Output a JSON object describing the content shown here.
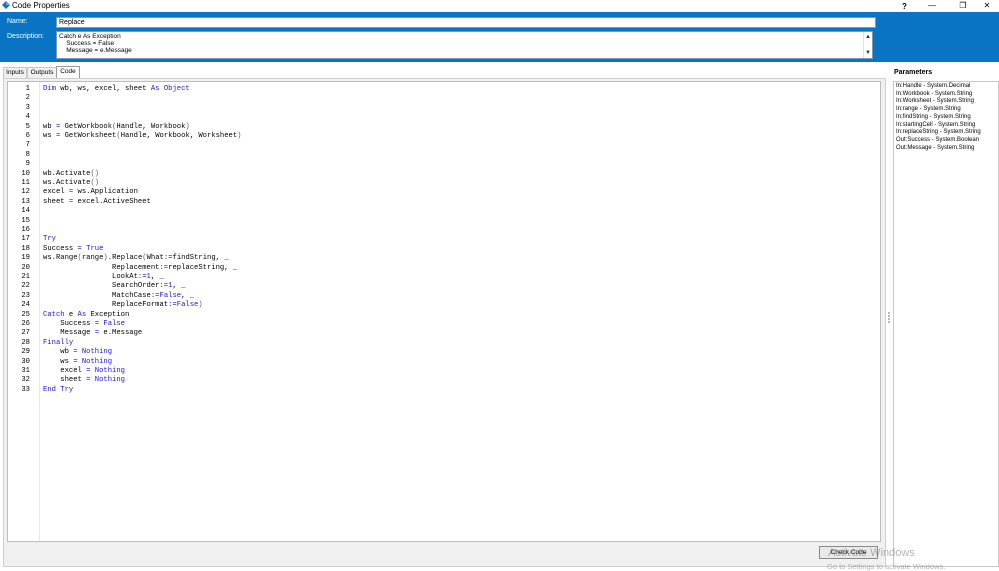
{
  "window": {
    "title": "Code Properties",
    "help": "?",
    "minimize": "—",
    "restore": "❐",
    "close": "✕"
  },
  "header": {
    "name_label": "Name:",
    "name_value": "Replace",
    "description_label": "Description:",
    "description_lines": [
      "Catch e As Exception",
      "    Success = False",
      "    Message = e.Message",
      "_"
    ],
    "scroll_up": "▲",
    "scroll_down": "▼"
  },
  "tabs": [
    "Inputs",
    "Outputs",
    "Code"
  ],
  "active_tab": "Code",
  "code": {
    "line_numbers": [
      "1",
      "2",
      "3",
      "4",
      "5",
      "6",
      "7",
      "8",
      "9",
      "10",
      "11",
      "12",
      "13",
      "14",
      "15",
      "16",
      "17",
      "18",
      "19",
      "20",
      "21",
      "22",
      "23",
      "24",
      "25",
      "26",
      "27",
      "28",
      "29",
      "30",
      "31",
      "32",
      "33"
    ],
    "lines": [
      "Dim wb, ws, excel, sheet As Object",
      "",
      "",
      "",
      "wb = GetWorkbook(Handle, Workbook)",
      "ws = GetWorksheet(Handle, Workbook, Worksheet)",
      "",
      "",
      "",
      "wb.Activate()",
      "ws.Activate()",
      "excel = ws.Application",
      "sheet = excel.ActiveSheet",
      "",
      "",
      "",
      "Try",
      "Success = True",
      "ws.Range(range).Replace(What:=findString, _",
      "                Replacement:=replaceString, _",
      "                LookAt:=1, _",
      "                SearchOrder:=1, _",
      "                MatchCase:=False, _",
      "                ReplaceFormat:=False)",
      "Catch e As Exception",
      "    Success = False",
      "    Message = e.Message",
      "Finally",
      "    wb = Nothing",
      "    ws = Nothing",
      "    excel = Nothing",
      "    sheet = Nothing",
      "End Try"
    ]
  },
  "check_code_label": "Check Code",
  "parameters": {
    "title": "Parameters",
    "items": [
      "In:Handle - System.Decimal",
      "In:Workbook - System.String",
      "In:Worksheet - System.String",
      "In:range - System.String",
      "In:findString - System.String",
      "In:startingCell - System.String",
      "In:replaceString - System.String",
      "Out:Success - System.Boolean",
      "Out:Message - System.String"
    ]
  },
  "watermark": {
    "line1": "Activate Windows",
    "line2": "Go to Settings to activate Windows."
  },
  "colors": {
    "header_band": "#0a74c4",
    "keyword": "#1818d8"
  }
}
